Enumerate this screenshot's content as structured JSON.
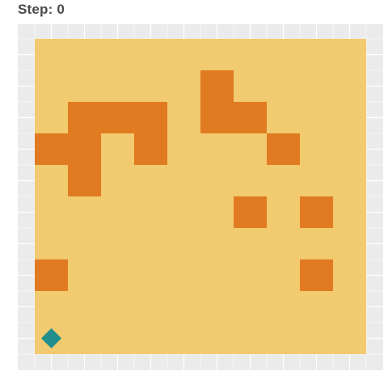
{
  "header": {
    "step_label": "Step: 0"
  },
  "board": {
    "columns": 10,
    "rows": 10,
    "colors": {
      "panel_background": "#ebebeb",
      "gridline": "#ffffff",
      "floor": "#f2ca6f",
      "wall": "#e07b22",
      "agent": "#21908c"
    },
    "walls": [
      {
        "col": 5,
        "row": 1
      },
      {
        "col": 1,
        "row": 2
      },
      {
        "col": 2,
        "row": 2
      },
      {
        "col": 3,
        "row": 2
      },
      {
        "col": 5,
        "row": 2
      },
      {
        "col": 6,
        "row": 2
      },
      {
        "col": 0,
        "row": 3
      },
      {
        "col": 1,
        "row": 3
      },
      {
        "col": 3,
        "row": 3
      },
      {
        "col": 7,
        "row": 3
      },
      {
        "col": 1,
        "row": 4
      },
      {
        "col": 6,
        "row": 5
      },
      {
        "col": 8,
        "row": 5
      },
      {
        "col": 0,
        "row": 7
      },
      {
        "col": 8,
        "row": 7
      }
    ],
    "agent": {
      "col": 0,
      "row": 9,
      "icon": "diamond-icon"
    }
  }
}
